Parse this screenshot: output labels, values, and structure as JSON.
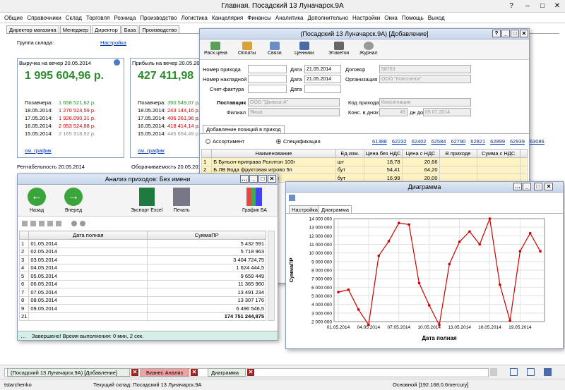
{
  "app": {
    "title": "Главная. Посадский   13 Луначарск.9А",
    "help": "?",
    "minimize": "–",
    "maximize": "□",
    "close": "✕"
  },
  "menu": [
    "Общие",
    "Справочники",
    "Склад",
    "Торговля",
    "Розница",
    "Производство",
    "Логистика",
    "Канцелярия",
    "Финансы",
    "Аналитика",
    "Дополнительно",
    "Настройки",
    "Окна",
    "Помощь",
    "Выход"
  ],
  "tabs": [
    "Директор магазина",
    "Менеджер",
    "Директор",
    "База",
    "Производство"
  ],
  "dashboard": {
    "group_label": "Группа склада:",
    "group_value": "Настройка",
    "revenue": {
      "title": "Выручка на вечер 20.05.2014",
      "value": "1 995 604,96 р.",
      "rows": [
        {
          "label": "Позавчера:",
          "value": "1 658 521,62 р.",
          "color": "green"
        },
        {
          "label": "18.05.2014:",
          "value": "1 270 524,59 р.",
          "color": "red"
        },
        {
          "label": "17.05.2014:",
          "value": "1 926.090,31 р.",
          "color": "red"
        },
        {
          "label": "16.05.2014:",
          "value": "2 053 524,88 р.",
          "color": "red"
        },
        {
          "label": "15.05.2014:",
          "value": "2 165 318,92 р.",
          "color": "gray"
        }
      ],
      "link": "см. график"
    },
    "profit": {
      "title": "Прибыль на вечер 20.05.2014",
      "value": "427 411,98",
      "rows": [
        {
          "label": "Позавчера:",
          "value": "350 549,07 р.",
          "color": "green"
        },
        {
          "label": "18.05.2014:",
          "value": "243 144,16 р.",
          "color": "red"
        },
        {
          "label": "17.05.2014:",
          "value": "406 261,96 р.",
          "color": "red"
        },
        {
          "label": "16.05.2014:",
          "value": "418 414,14 р.",
          "color": "red"
        },
        {
          "label": "15.05.2014:",
          "value": "445 654,49 р.",
          "color": "gray"
        }
      ],
      "link": "см. график"
    },
    "rentab": "Рентабельность 20.05.2014",
    "turnover": "Оборачиваемость 20.05.2014"
  },
  "receipt": {
    "title": "(Посадский   13 Луначарск.9А) [Добавление]",
    "toolbar": [
      "Расх.цена",
      "Оплаты",
      "Связи",
      "Ценники",
      "Этикетки",
      "Журнал"
    ],
    "labels": {
      "num": "Номер прихода",
      "waybill": "Номер накладной",
      "invoice": "Счет-фактура",
      "date": "Дата",
      "contract": "Договор",
      "org": "Организация",
      "supplier": "Поставщик",
      "branch": "Филиал",
      "code": "Код прихода",
      "cons": "Конс. в днях",
      "to": "дн до"
    },
    "values": {
      "date1": "21.05.2014",
      "date2": "21.05.2014",
      "contract": "58763",
      "org": "ООО \"Константа\"",
      "supplier": "ООО \"Джокса-А\"",
      "branch": "Якша",
      "code": "Консигнация",
      "days": "45",
      "to_date": "05.07.2014"
    },
    "subtab": "Добавление позиций в приход",
    "radio_a": "Ассортимент",
    "radio_b": "Спецификация",
    "codes": [
      "61388",
      "62232",
      "62402",
      "62584",
      "62790",
      "62821",
      "62899",
      "62939",
      "63086"
    ],
    "cols": [
      "Наименование",
      "Ед.изм.",
      "Цена без НДС",
      "Цена с НДС",
      "В приходе",
      "Сумма с НДС"
    ],
    "rows": [
      {
        "n": "1",
        "name": "Б Бульон-приправа Роллтон 100г",
        "unit": "шт",
        "p1": "18,78",
        "p2": "20,66"
      },
      {
        "n": "2",
        "name": "Б ЛВ Вода фруктовая игрово     5п",
        "unit": "бут",
        "p1": "54,41",
        "p2": "64,20"
      },
      {
        "n": "3",
        "name": "Б ЛВ Вода фруктовая 1.5л",
        "unit": "бут",
        "p1": "16,99",
        "p2": "20,00"
      }
    ]
  },
  "analysis": {
    "title": "Анализ приходов: Без имени",
    "toolbar": [
      "Назад",
      "Вперед",
      "Экспорт Excel",
      "Печать",
      "График БА"
    ],
    "cols": [
      "Дата полная",
      "СуммаПР"
    ],
    "rows": [
      [
        "1",
        "01.05.2014",
        "5 432 591"
      ],
      [
        "2",
        "02.05.2014",
        "5 718 963"
      ],
      [
        "3",
        "03.05.2014",
        "3 404 724,75"
      ],
      [
        "4",
        "04.05.2014",
        "1 624 444,5"
      ],
      [
        "5",
        "05.05.2014",
        "9 659 449"
      ],
      [
        "6",
        "06.05.2014",
        "11 365 960"
      ],
      [
        "7",
        "07.05.2014",
        "13 491 234"
      ],
      [
        "8",
        "08.05.2014",
        "13 307 176"
      ],
      [
        "9",
        "09.05.2014",
        "6 496 546,5"
      ]
    ],
    "footer_n": "21",
    "total": "174 751 244,875",
    "status": "Завершено! Время выполнения: 0 мин, 2 сек."
  },
  "diagram": {
    "title": "Диаграмма",
    "tabs": [
      "Настройка",
      "Диаграмма"
    ]
  },
  "chart_data": {
    "type": "line",
    "x": [
      "01.05.2014",
      "02.05.2014",
      "03.05.2014",
      "04.05.2014",
      "05.05.2014",
      "06.05.2014",
      "07.05.2014",
      "08.05.2014",
      "09.05.2014",
      "10.05.2014",
      "11.05.2014",
      "12.05.2014",
      "13.05.2014",
      "14.05.2014",
      "15.05.2014",
      "16.05.2014",
      "17.05.2014",
      "18.05.2014",
      "19.05.2014",
      "20.05.2014",
      "21.05.2014"
    ],
    "values": [
      5432591,
      5718963,
      3404724.75,
      1624444.5,
      9659449,
      11365960,
      13491234,
      13307176,
      6496546.5,
      3900000,
      1600000,
      8700000,
      11300000,
      12500000,
      11000000,
      14000000,
      6300000,
      2100000,
      10200000,
      12300000,
      10200000
    ],
    "xticks": [
      "01.05.2014",
      "04.05.2014",
      "07.05.2014",
      "10.05.2014",
      "13.05.2014",
      "16.05.2014",
      "19.05.2014"
    ],
    "yticks": [
      "2 000 000",
      "3 000 000",
      "4 000 000",
      "5 000 000",
      "6 000 000",
      "7 000 000",
      "8 000 000",
      "9 000 000",
      "10 000 000",
      "11 000 000",
      "12 000 000",
      "13 000 000",
      "14 000 000"
    ],
    "ylim": [
      2000000,
      14000000
    ],
    "xlabel": "Дата полная",
    "ylabel": "СуммаПР",
    "color": "#cc0000",
    "grid": true
  },
  "taskbar": [
    "(Посадский   13 Луначарск.9А)  [Добавление]",
    "Бизнес Анализ",
    "Диаграмма"
  ],
  "status": {
    "user": "tstarchenko",
    "warehouse": "Текущий склад: Посадский   13 Луначарск.9А",
    "server": "Основной [192.168.0.6mercury]"
  }
}
